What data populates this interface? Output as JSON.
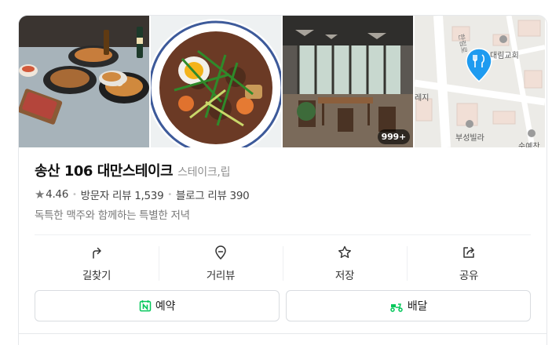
{
  "photos": [
    {
      "name": "food-platter-photo",
      "icon": "food-photo"
    },
    {
      "name": "braised-beef-bowl-photo",
      "icon": "food-photo"
    },
    {
      "name": "restaurant-interior-photo",
      "icon": "interior-photo",
      "badge": "999+"
    },
    {
      "name": "map-thumbnail",
      "icon": "map",
      "labels": {
        "church": "대림교회",
        "villa": "부성빌라",
        "street": "한림로",
        "shop": "순예찬",
        "side": "레지"
      }
    }
  ],
  "place": {
    "name": "송산 106 대만스테이크",
    "category": "스테이크,립",
    "rating": "4.46",
    "visitor_reviews": "방문자 리뷰 1,539",
    "blog_reviews": "블로그 리뷰 390",
    "description": "독특한 맥주와 함께하는 특별한 저녁"
  },
  "actions": [
    {
      "label": "길찾기",
      "icon": "directions-icon"
    },
    {
      "label": "거리뷰",
      "icon": "location-pin-icon"
    },
    {
      "label": "저장",
      "icon": "star-outline-icon"
    },
    {
      "label": "공유",
      "icon": "share-icon"
    }
  ],
  "buttons": {
    "reserve": "예약",
    "delivery": "배달"
  },
  "colors": {
    "map_pin": "#1e9bf0",
    "naver_green": "#03c75a"
  }
}
